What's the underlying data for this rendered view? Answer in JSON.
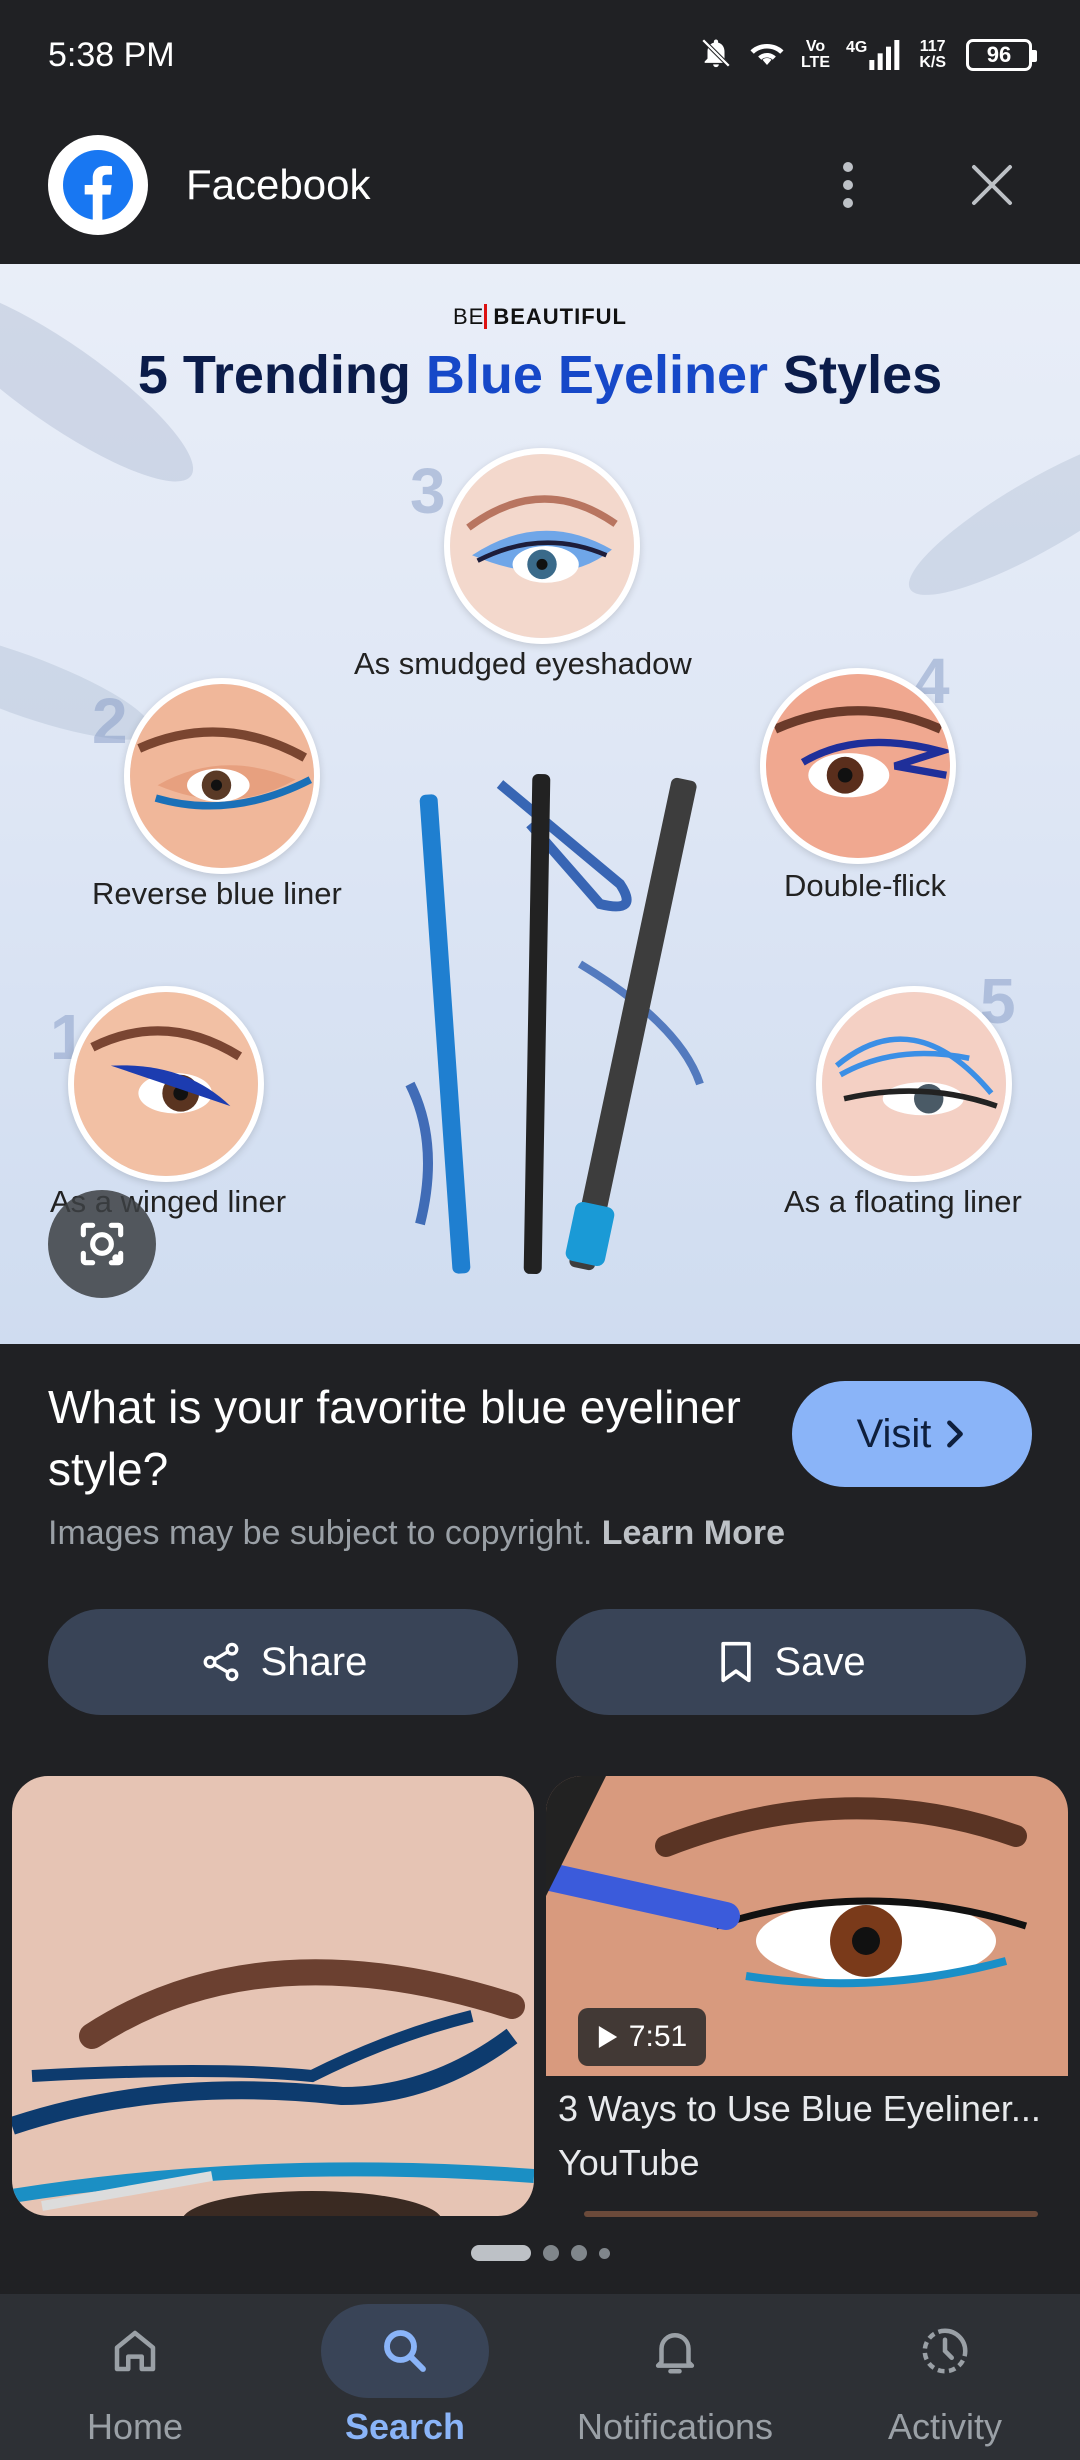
{
  "status_bar": {
    "time": "5:38 PM",
    "network_top": "Vo",
    "network_bottom": "LTE",
    "signal_type": "4G",
    "speed_value": "117",
    "speed_unit": "K/S",
    "battery": "96"
  },
  "header": {
    "source_name": "Facebook",
    "more_icon": "more-vert-icon",
    "close_icon": "close-icon"
  },
  "image": {
    "brand_left": "BE",
    "brand_right": "BEAUTIFUL",
    "title_part1": "5 Trending ",
    "title_part2": "Blue Eyeliner",
    "title_part3": " Styles",
    "styles": [
      {
        "number": "3",
        "caption": "As smudged eyeshadow"
      },
      {
        "number": "2",
        "caption": "Reverse blue liner"
      },
      {
        "number": "4",
        "caption": "Double-flick"
      },
      {
        "number": "1",
        "caption": "As a winged liner"
      },
      {
        "number": "5",
        "caption": "As a floating liner"
      }
    ]
  },
  "info": {
    "title": "What is your favorite blue eyeliner style?",
    "visit_label": "Visit",
    "copyright_text": "Images may be subject to copyright.",
    "learn_more": "Learn More"
  },
  "actions": {
    "share_label": "Share",
    "save_label": "Save"
  },
  "results": [
    {
      "type": "image"
    },
    {
      "type": "video",
      "duration": "7:51",
      "title": "3 Ways to Use Blue Eyeliner...",
      "source": "YouTube"
    }
  ],
  "pagination": {
    "pages": 4,
    "active": 0
  },
  "bottom_nav": {
    "items": [
      {
        "label": "Home",
        "icon": "home-icon"
      },
      {
        "label": "Search",
        "icon": "search-icon"
      },
      {
        "label": "Notifications",
        "icon": "bell-icon"
      },
      {
        "label": "Activity",
        "icon": "activity-icon"
      }
    ],
    "active_index": 1
  },
  "colors": {
    "background": "#202124",
    "accent": "#8ab4f8",
    "button_bg": "#394457",
    "nav_bg": "#2d3035"
  }
}
